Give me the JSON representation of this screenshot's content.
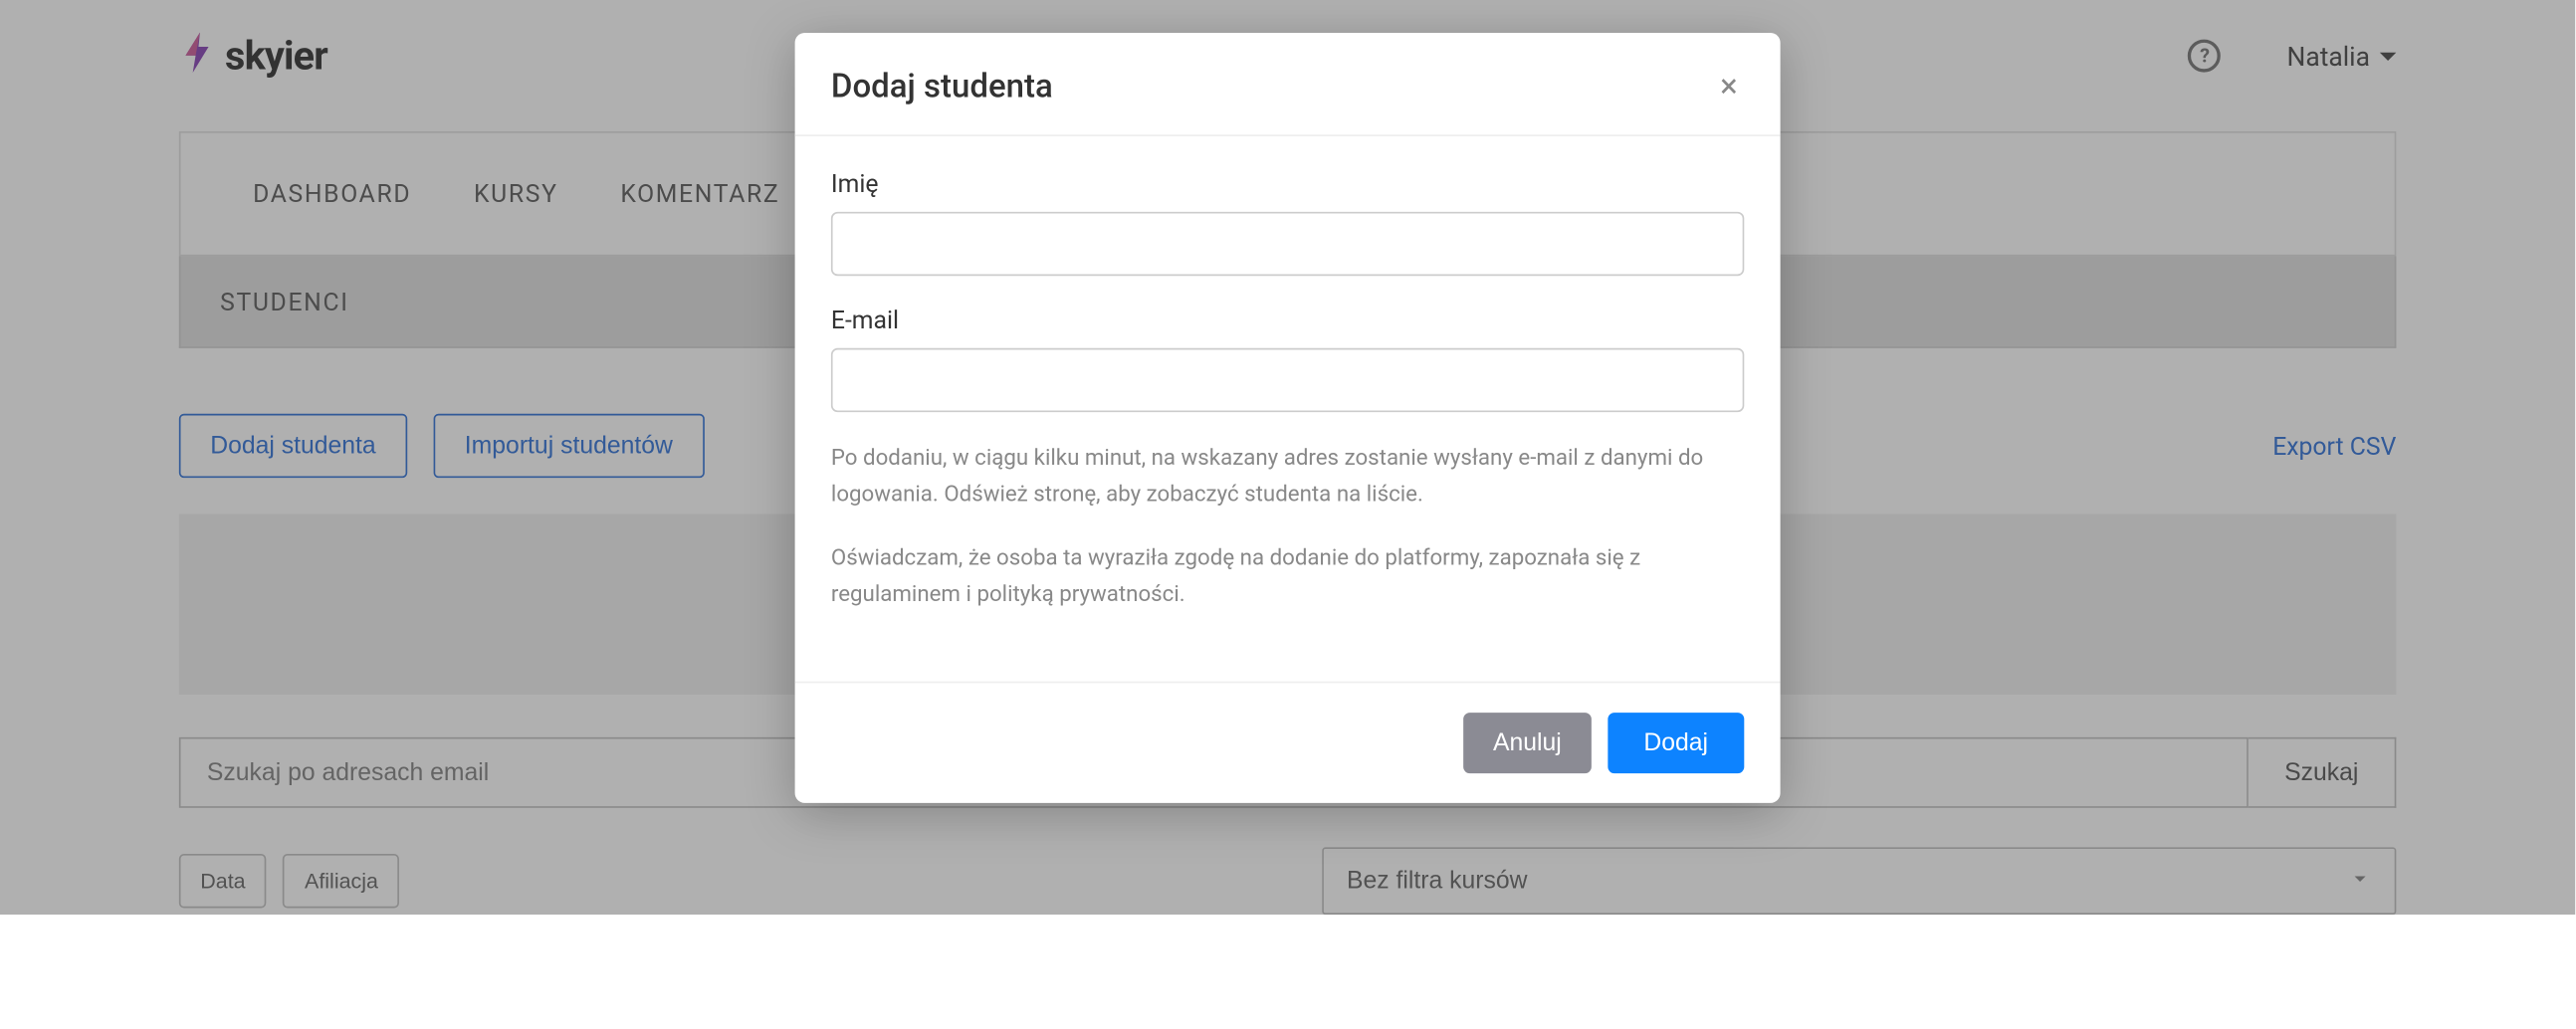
{
  "brand": {
    "name": "skyier"
  },
  "topbar": {
    "user_name": "Natalia"
  },
  "nav": {
    "tabs": [
      "DASHBOARD",
      "KURSY",
      "KOMENTARZ"
    ],
    "page_title": "STUDENCI"
  },
  "actions": {
    "add_student": "Dodaj studenta",
    "import_students": "Importuj studentów",
    "export_csv": "Export CSV"
  },
  "search": {
    "placeholder": "Szukaj po adresach email",
    "button": "Szukaj"
  },
  "filters": {
    "date": "Data",
    "affiliation": "Afiliacja",
    "course_filter_selected": "Bez filtra kursów"
  },
  "modal": {
    "title": "Dodaj studenta",
    "name_label": "Imię",
    "email_label": "E-mail",
    "helper1": "Po dodaniu, w ciągu kilku minut, na wskazany adres zostanie wysłany e-mail z danymi do logowania. Odśwież stronę, aby zobaczyć studenta na liście.",
    "helper2": "Oświadczam, że osoba ta wyraziła zgodę na dodanie do platformy, zapoznała się z regulaminem i polityką prywatności.",
    "cancel": "Anuluj",
    "submit": "Dodaj"
  }
}
